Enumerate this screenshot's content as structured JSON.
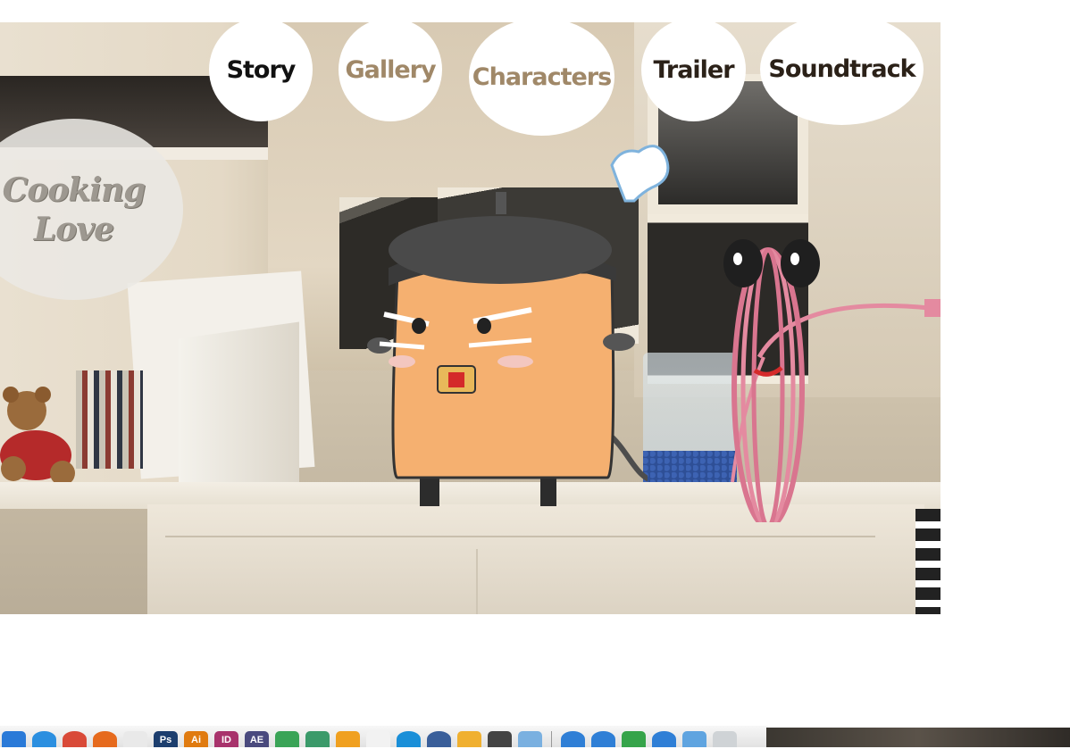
{
  "nav": {
    "items": [
      {
        "label": "Story"
      },
      {
        "label": "Gallery"
      },
      {
        "label": "Characters"
      },
      {
        "label": "Trailer"
      },
      {
        "label": "Soundtrack"
      }
    ]
  },
  "logo": {
    "line1": "Cooking",
    "line2": "Love"
  },
  "colors": {
    "nav_bubble": "#ffffff",
    "nav_text_dark": "#111111",
    "nav_text_tan": "#a08868",
    "toaster_body": "#f5b070",
    "toaster_lid": "#3a3a3a",
    "whisk": "#e48aa0"
  },
  "dock": {
    "icons": [
      {
        "name": "finder-icon",
        "color": "#2a7ad8",
        "text": ""
      },
      {
        "name": "safari-icon",
        "color": "#2b8fe0",
        "text": ""
      },
      {
        "name": "chrome-icon",
        "color": "#d94a38",
        "text": ""
      },
      {
        "name": "firefox-icon",
        "color": "#e66a1d",
        "text": ""
      },
      {
        "name": "textedit-icon",
        "color": "#e9e9e9",
        "text": ""
      },
      {
        "name": "photoshop-icon",
        "color": "#1c3e6e",
        "text": "Ps"
      },
      {
        "name": "illustrator-icon",
        "color": "#e07b10",
        "text": "Ai"
      },
      {
        "name": "indesign-icon",
        "color": "#a8336c",
        "text": "ID"
      },
      {
        "name": "aftereffects-icon",
        "color": "#4a4a7e",
        "text": "AE"
      },
      {
        "name": "drive-icon",
        "color": "#3aa457",
        "text": ""
      },
      {
        "name": "dreamweaver-icon",
        "color": "#3b9a6a",
        "text": ""
      },
      {
        "name": "settings-icon",
        "color": "#f0a020",
        "text": ""
      },
      {
        "name": "pencil-icon",
        "color": "#f2f2f2",
        "text": ""
      },
      {
        "name": "skype-icon",
        "color": "#1a8fd8",
        "text": ""
      },
      {
        "name": "globe-icon",
        "color": "#3a5f9a",
        "text": ""
      },
      {
        "name": "cheese-icon",
        "color": "#f0b030",
        "text": ""
      },
      {
        "name": "star-icon",
        "color": "#444444",
        "text": ""
      },
      {
        "name": "preview-icon",
        "color": "#7ab0e0",
        "text": ""
      },
      {
        "name": "web1-icon",
        "color": "#2f7fd6",
        "text": ""
      },
      {
        "name": "web2-icon",
        "color": "#2f7fd6",
        "text": ""
      },
      {
        "name": "calendar-icon",
        "color": "#36a44a",
        "text": ""
      },
      {
        "name": "web3-icon",
        "color": "#2f7fd6",
        "text": ""
      },
      {
        "name": "folder-icon",
        "color": "#5fa4e0",
        "text": ""
      },
      {
        "name": "trash-icon",
        "color": "#cfd3d6",
        "text": ""
      }
    ]
  }
}
